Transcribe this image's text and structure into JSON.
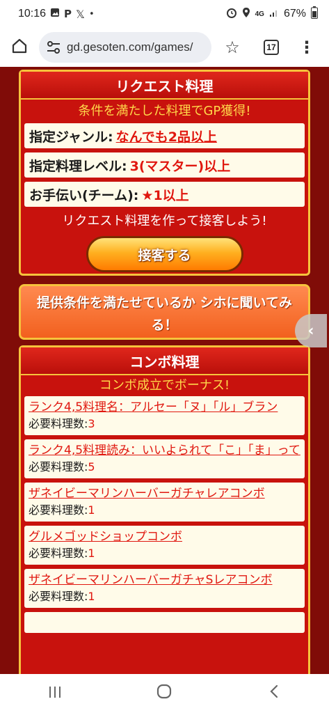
{
  "status": {
    "time": "10:16",
    "network": "4G",
    "battery": "67%"
  },
  "browser": {
    "url": "gd.gesoten.com/games/",
    "tab_count": "17"
  },
  "request": {
    "title": "リクエスト料理",
    "subtitle": "条件を満たした料理でGP獲得!",
    "conditions": [
      {
        "label": "指定ジャンル:",
        "value": "なんでも2品以上"
      },
      {
        "label": "指定料理レベル:",
        "value": "3(マスター)以上"
      },
      {
        "label": "お手伝い(チーム):",
        "value": "★1以上"
      }
    ],
    "message": "リクエスト料理を作って接客しよう!",
    "serve_label": "接客する"
  },
  "ask_label": "提供条件を満たせているか シホに聞いてみる！",
  "combo": {
    "title": "コンボ料理",
    "subtitle": "コンボ成立でボーナス!",
    "req_label": "必要料理数:",
    "items": [
      {
        "name": "ランク4,5料理名：アルセー「ヌ」「ル」ブラン",
        "count": "3"
      },
      {
        "name": "ランク4,5料理読み：いいよられて「こ」「ま」って",
        "count": "5"
      },
      {
        "name": "ザネイビーマリンハーバーガチャレアコンボ",
        "count": "1"
      },
      {
        "name": "グルメゴッドショップコンボ",
        "count": "1"
      },
      {
        "name": "ザネイビーマリンハーバーガチャSレアコンボ",
        "count": "1"
      }
    ]
  },
  "icons": {
    "home": "home-icon",
    "tune": "tune-icon",
    "star": "star-icon",
    "menu": "more-vert-icon",
    "back_arrow": "chevron-left-icon"
  },
  "colors": {
    "accent_red": "#c8120d",
    "gold_border": "#f6c33c",
    "link_red": "#e0170f"
  }
}
